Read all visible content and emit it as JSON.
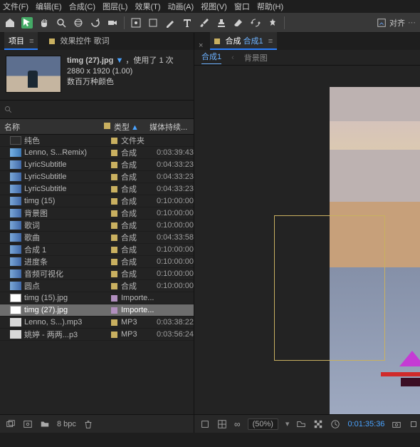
{
  "menus": [
    "文件(F)",
    "编辑(E)",
    "合成(C)",
    "图层(L)",
    "效果(T)",
    "动画(A)",
    "视图(V)",
    "窗口",
    "帮助(H)"
  ],
  "align_label": "对齐",
  "left_tabs": {
    "project": "项目",
    "menu_icon": "≡",
    "fx_tab": "效果控件 歌词"
  },
  "asset": {
    "name": "timg (27).jpg",
    "used": "，使用了 1 次",
    "dims": "2880 x 1920 (1.00)",
    "colors": "数百万种颜色"
  },
  "columns": {
    "name": "名称",
    "type": "类型",
    "duration": "媒体持续..."
  },
  "rows": [
    {
      "icon": "folder",
      "name": "纯色",
      "swatch": "#c9b060",
      "type": "文件夹",
      "dur": ""
    },
    {
      "icon": "video",
      "name": "Lenno, S...Remix)",
      "swatch": "#c9b060",
      "type": "合成",
      "dur": "0:03:39:43"
    },
    {
      "icon": "comp",
      "name": "LyricSubtitle",
      "swatch": "#c9b060",
      "type": "合成",
      "dur": "0:04:33:23"
    },
    {
      "icon": "comp",
      "name": "LyricSubtitle",
      "swatch": "#c9b060",
      "type": "合成",
      "dur": "0:04:33:23"
    },
    {
      "icon": "comp",
      "name": "LyricSubtitle",
      "swatch": "#c9b060",
      "type": "合成",
      "dur": "0:04:33:23"
    },
    {
      "icon": "comp",
      "name": "timg (15)",
      "swatch": "#c9b060",
      "type": "合成",
      "dur": "0:10:00:00"
    },
    {
      "icon": "comp",
      "name": "背景图",
      "swatch": "#c9b060",
      "type": "合成",
      "dur": "0:10:00:00"
    },
    {
      "icon": "comp",
      "name": "歌词",
      "swatch": "#c9b060",
      "type": "合成",
      "dur": "0:10:00:00"
    },
    {
      "icon": "comp",
      "name": "歌曲",
      "swatch": "#c9b060",
      "type": "合成",
      "dur": "0:04:33:58"
    },
    {
      "icon": "comp",
      "name": "合成 1",
      "swatch": "#c9b060",
      "type": "合成",
      "dur": "0:10:00:00"
    },
    {
      "icon": "comp",
      "name": "进度条",
      "swatch": "#c9b060",
      "type": "合成",
      "dur": "0:10:00:00"
    },
    {
      "icon": "comp",
      "name": "音频可视化",
      "swatch": "#c9b060",
      "type": "合成",
      "dur": "0:10:00:00"
    },
    {
      "icon": "comp",
      "name": "圆点",
      "swatch": "#c9b060",
      "type": "合成",
      "dur": "0:10:00:00"
    },
    {
      "icon": "image",
      "name": "timg (15).jpg",
      "swatch": "#b18fbe",
      "type": "Importe...",
      "dur": ""
    },
    {
      "icon": "image",
      "name": "timg (27).jpg",
      "swatch": "#b18fbe",
      "type": "Importe...",
      "dur": "",
      "sel": true
    },
    {
      "icon": "audio",
      "name": "Lenno, S...).mp3",
      "swatch": "#c9b060",
      "type": "MP3",
      "dur": "0:03:38:22"
    },
    {
      "icon": "audio",
      "name": "姚婷 - 两两...p3",
      "swatch": "#c9b060",
      "type": "MP3",
      "dur": "0:03:56:24"
    }
  ],
  "bpc": "8 bpc",
  "comp_tab": {
    "prefix": "合成",
    "name": "合成1",
    "menu": "≡"
  },
  "sub_tabs": [
    "合成1",
    "背景图"
  ],
  "viewer": {
    "pct": "(50%)",
    "tc": "0:01:35:36"
  }
}
